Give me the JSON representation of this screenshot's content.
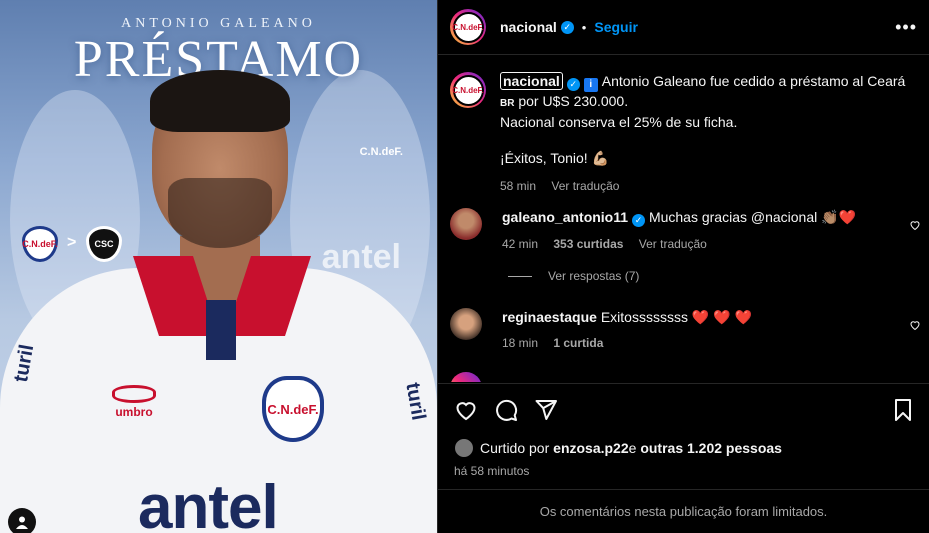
{
  "post_image": {
    "player_name": "ANTONIO GALEANO",
    "headline": "PRÉSTAMO",
    "crest_left": "C.N.deF.",
    "crest_right": "CSC",
    "arrow": ">",
    "bg_crest_text": "C.N.deF.",
    "bg_sponsor": "antel",
    "shirt_brand": "umbro",
    "shirt_badge": "C.N.deF.",
    "shirt_sponsor": "antel",
    "sleeve_sponsor": "turil"
  },
  "header": {
    "username": "nacional",
    "verified": "✓",
    "separator": "•",
    "follow_label": "Seguir",
    "more_label": "•••",
    "avatar_text": "C.N.deF."
  },
  "caption": {
    "username": "nacional",
    "text_line1": "Antonio Galeano fue cedido a préstamo al Ceará",
    "text_br": "BR",
    "text_line2": " por U$S 230.000.",
    "text_line3": "Nacional conserva el 25% de su ficha.",
    "text_line4": "¡Éxitos, Tonio! 💪🏼",
    "time": "58 min",
    "translate": "Ver tradução"
  },
  "comments": [
    {
      "username": "galeano_antonio11",
      "text": "Muchas gracias @nacional 👏🏽❤️",
      "time": "42 min",
      "likes": "353 curtidas",
      "translate": "Ver tradução",
      "replies": "Ver respostas (7)"
    },
    {
      "username": "reginaestaque",
      "text": "Exitossssssss ❤️ ❤️ ❤️",
      "time": "18 min",
      "likes": "1 curtida"
    }
  ],
  "likes_summary": {
    "prefix": "Curtido por ",
    "user": "enzosa.p22",
    "middle": " e ",
    "others": "outras 1.202 pessoas"
  },
  "post_time": "há 58 minutos",
  "comments_limited": "Os comentários nesta publicação foram limitados."
}
